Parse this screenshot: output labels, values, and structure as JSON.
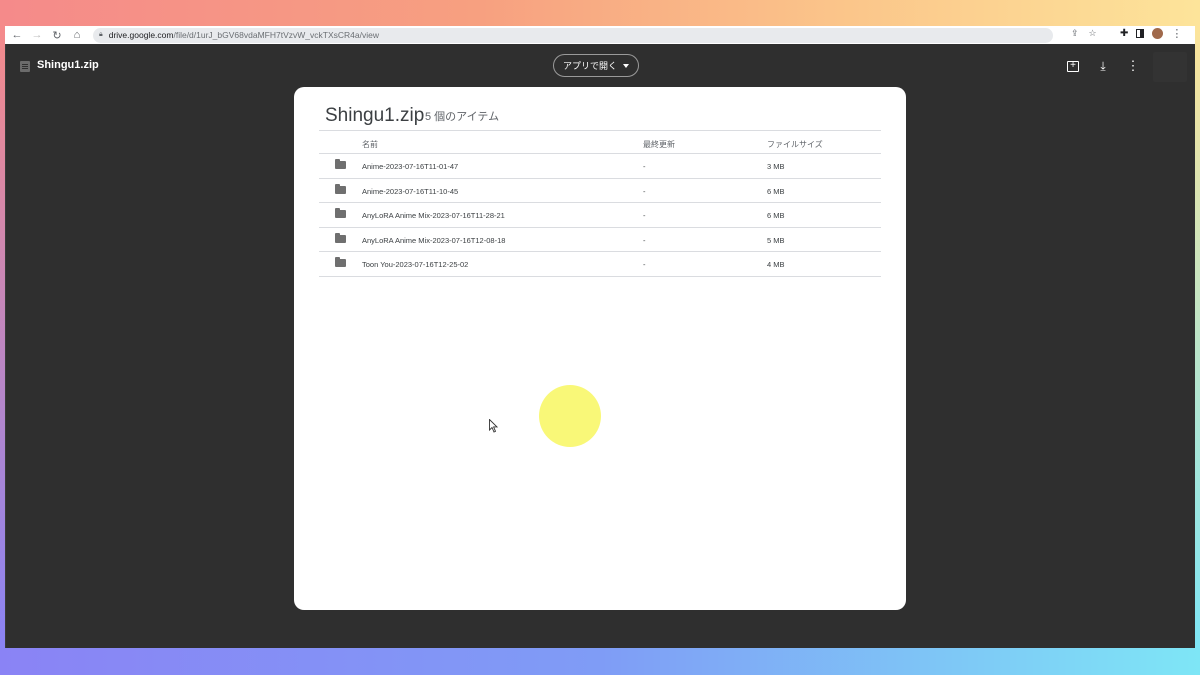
{
  "browser": {
    "url_host": "drive.google.com",
    "url_path": "/file/d/1urJ_bGV68vdaMFH7tVzvW_vckTXsCR4a/view"
  },
  "header": {
    "file_name": "Shingu1.zip",
    "open_with_label": "アプリで開く"
  },
  "archive": {
    "title": "Shingu1.zip",
    "item_count": "5 個のアイテム",
    "columns": {
      "name": "名前",
      "modified": "最終更新",
      "size": "ファイルサイズ"
    },
    "rows": [
      {
        "name": "Anime-2023-07-16T11-01-47",
        "modified": "-",
        "size": "3 MB"
      },
      {
        "name": "Anime-2023-07-16T11-10-45",
        "modified": "-",
        "size": "6 MB"
      },
      {
        "name": "AnyLoRA Anime Mix-2023-07-16T11-28-21",
        "modified": "-",
        "size": "6 MB"
      },
      {
        "name": "AnyLoRA Anime Mix-2023-07-16T12-08-18",
        "modified": "-",
        "size": "5 MB"
      },
      {
        "name": "Toon You-2023-07-16T12-25-02",
        "modified": "-",
        "size": "4 MB"
      }
    ]
  },
  "colors": {
    "dark_bg": "#2f2f2f",
    "highlight": "#f9f871"
  }
}
